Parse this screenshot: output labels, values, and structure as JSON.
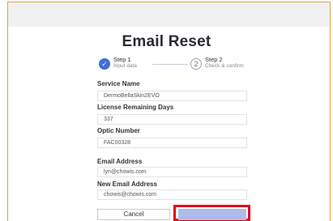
{
  "page": {
    "title": "Email Reset"
  },
  "steps": [
    {
      "number": "✓",
      "title": "Step 1",
      "sub": "Input data"
    },
    {
      "number": "2",
      "title": "Step 2",
      "sub": "Check & confirm"
    }
  ],
  "form": {
    "service_name": {
      "label": "Service Name",
      "value": "DermoBellaSkin2EVO"
    },
    "license_days": {
      "label": "License Remaining Days",
      "value": "337"
    },
    "optic_number": {
      "label": "Optic Number",
      "value": "FAC00328"
    },
    "email": {
      "label": "Email Address",
      "value": "lyn@chowis.com"
    },
    "new_email": {
      "label": "New Email Address",
      "value": "chowis@chowis.com"
    }
  },
  "buttons": {
    "cancel": "Cancel",
    "next": ""
  },
  "colors": {
    "accent": "#3f6fd8",
    "highlight": "#e4001b",
    "disabled_button": "#aebcea"
  }
}
